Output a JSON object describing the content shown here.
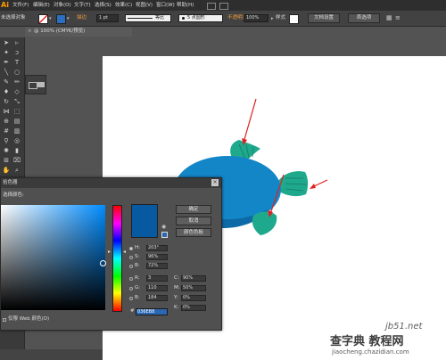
{
  "app": {
    "logo": "Ai"
  },
  "menubar": {
    "items": [
      "文件(F)",
      "编辑(E)",
      "对象(O)",
      "文字(T)",
      "选择(S)",
      "效果(C)",
      "视图(V)",
      "窗口(W)",
      "帮助(H)"
    ]
  },
  "control_bar": {
    "selection_label": "未选择对象",
    "stroke_label": "描边",
    "stroke_weight": "1 pt",
    "stroke_profile": "等比",
    "brush": "5 点圆形",
    "opacity_label": "不透明度",
    "opacity_value": "100%",
    "style_label": "样式",
    "doc_setup_button": "文档设置",
    "prefs_button": "首选项"
  },
  "document_tab": {
    "close": "×",
    "title": "@ 100% (CMYK/预览)"
  },
  "color_picker": {
    "title": "拾色器",
    "subtitle": "选择颜色:",
    "ok": "确定",
    "cancel": "取消",
    "swatches": "颜色色板",
    "fields": {
      "H": {
        "label": "H:",
        "value": "203°"
      },
      "S": {
        "label": "S:",
        "value": "96%"
      },
      "B": {
        "label": "B:",
        "value": "72%"
      },
      "R": {
        "label": "R:",
        "value": "3"
      },
      "G": {
        "label": "G:",
        "value": "110"
      },
      "Bl": {
        "label": "B:",
        "value": "184"
      },
      "C": {
        "label": "C:",
        "value": "90%"
      },
      "M": {
        "label": "M:",
        "value": "50%"
      },
      "Y": {
        "label": "Y:",
        "value": "0%"
      },
      "K": {
        "label": "K:",
        "value": "0%"
      }
    },
    "hex_label": "#",
    "hex_value": "036EB8",
    "web_only_label": "仅限 Web 颜色(O)",
    "swatch_color": "#0759A1"
  },
  "colors": {
    "fish_body": "#1386C8",
    "fish_fin": "#1FA98C"
  },
  "watermark": {
    "line1": "jb51.net",
    "line2": "查字典 教程网",
    "line3": "jiaocheng.chazidian.com"
  }
}
